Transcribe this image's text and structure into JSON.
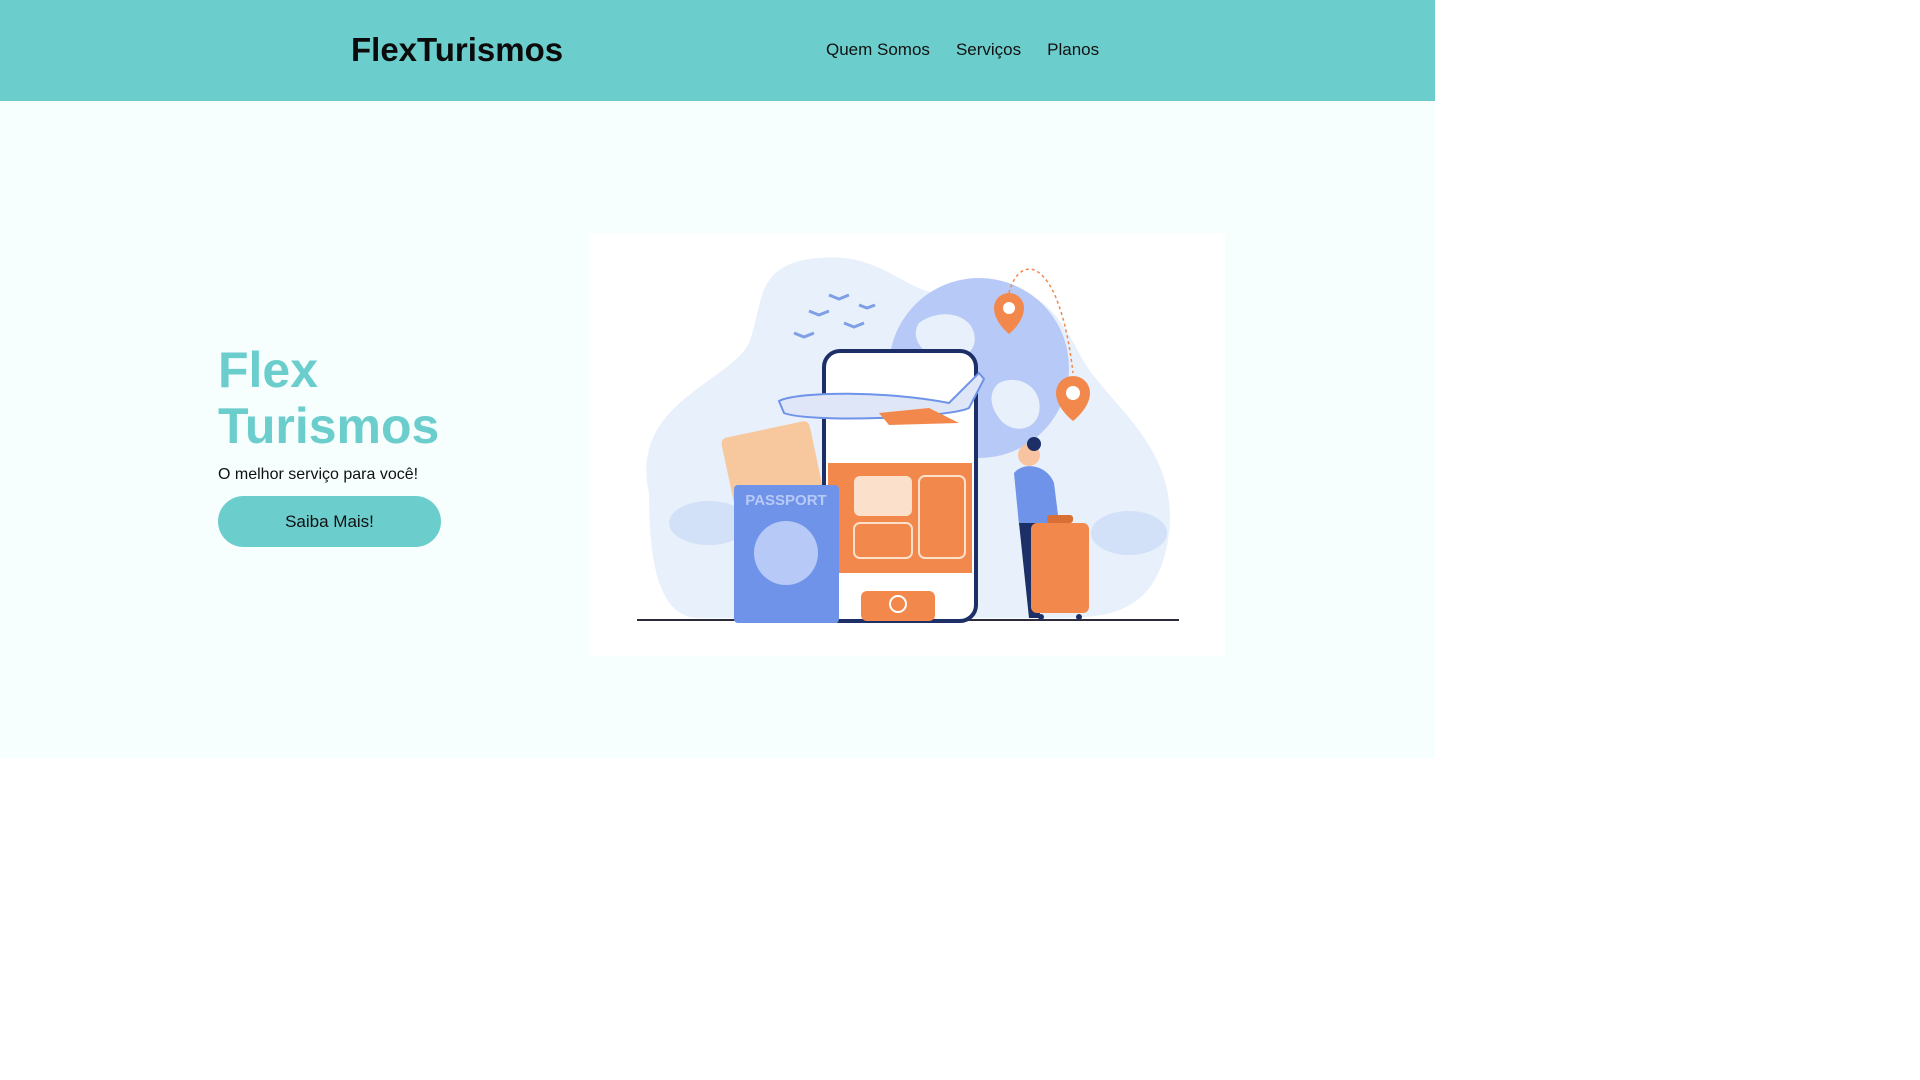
{
  "header": {
    "logo": "FlexTurismos",
    "nav": [
      {
        "label": "Quem Somos"
      },
      {
        "label": "Serviços"
      },
      {
        "label": "Planos"
      }
    ]
  },
  "hero": {
    "title_line1": "Flex",
    "title_line2": "Turismos",
    "subtitle": "O melhor serviço para você!",
    "cta_label": "Saiba Mais!"
  },
  "illustration": {
    "passport_text": "PASSPORT",
    "colors": {
      "brand": "#6ccdcd",
      "blue": "#6e93e8",
      "orange": "#f2884b",
      "navy": "#1c2f66"
    }
  }
}
